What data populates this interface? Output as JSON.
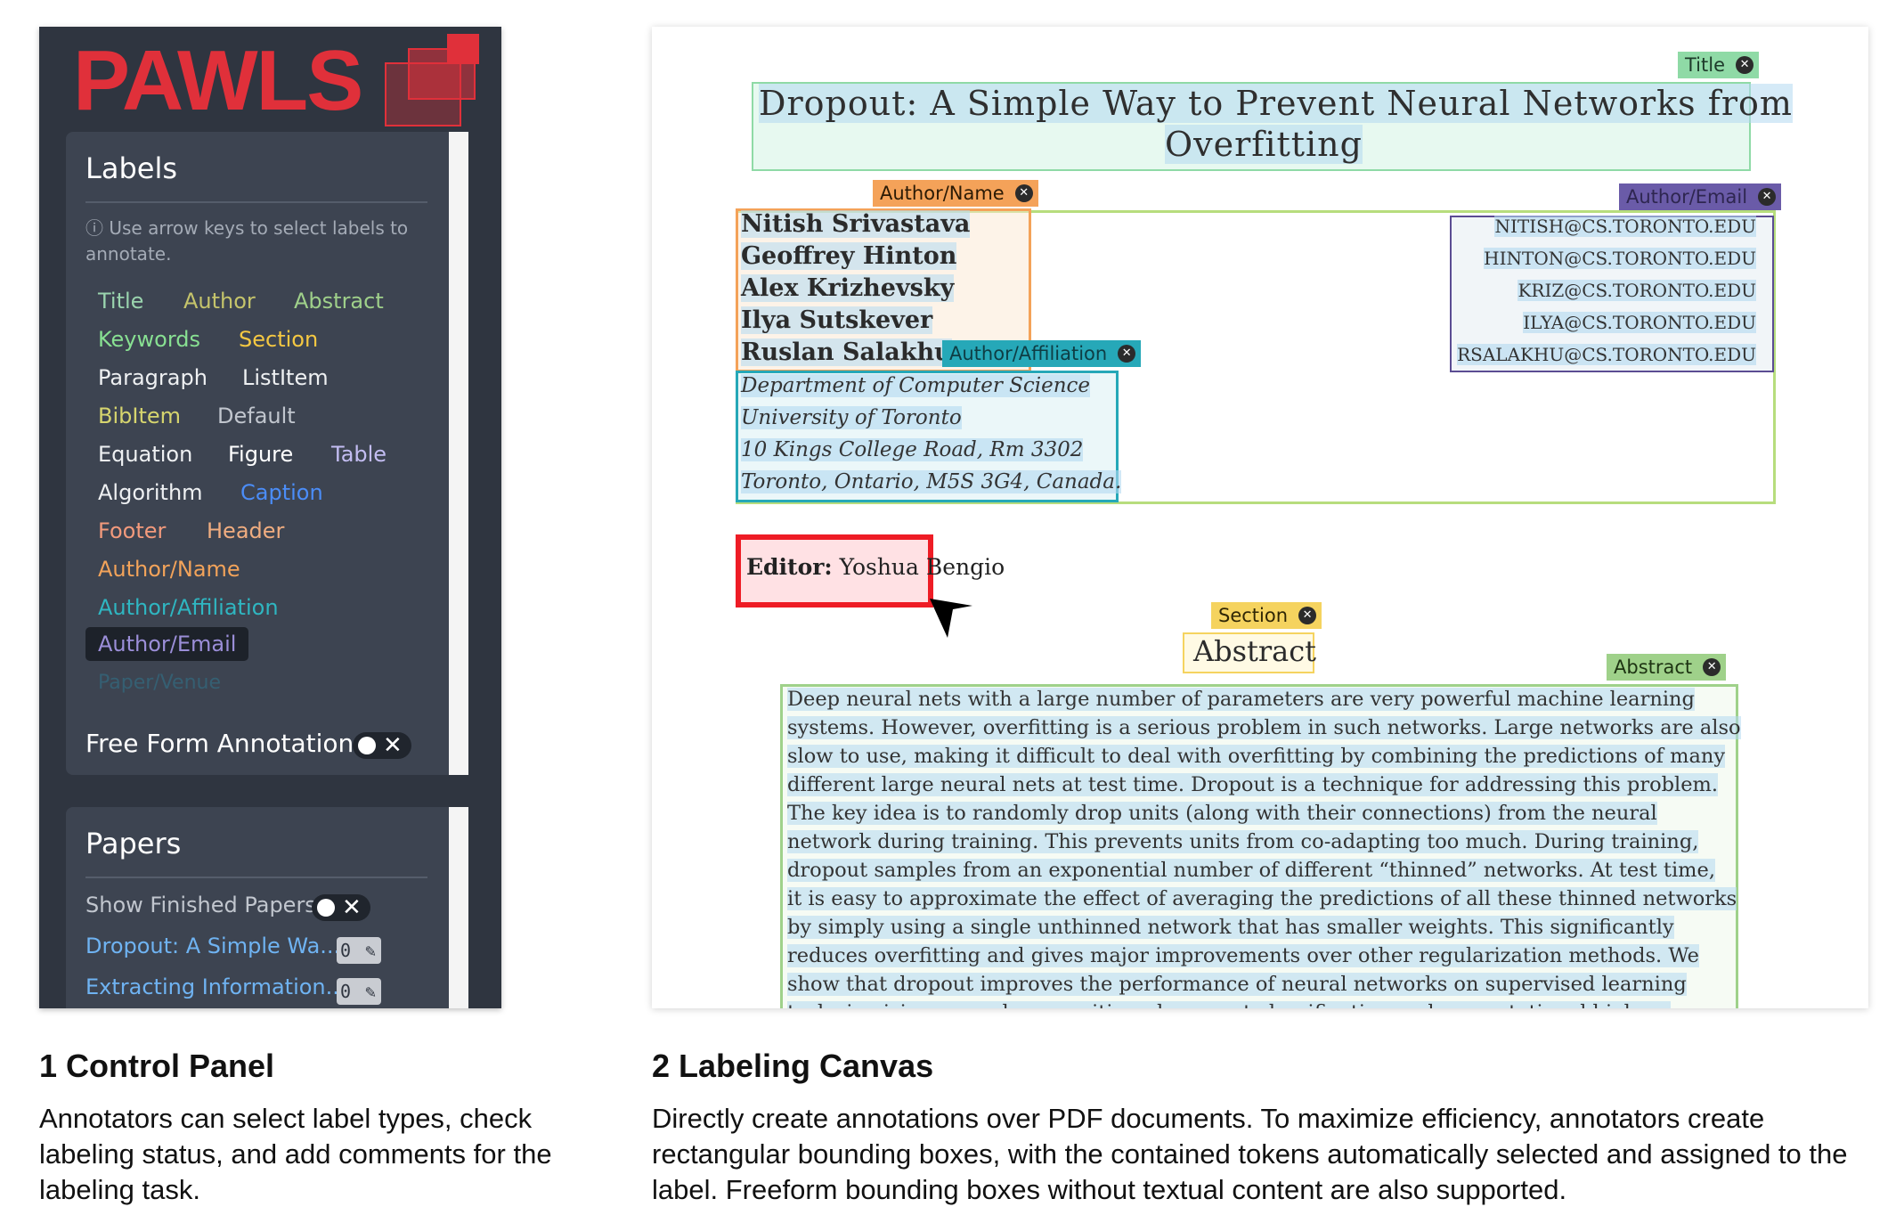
{
  "logo": {
    "text": "PAWLS"
  },
  "labels_card": {
    "heading": "Labels",
    "hint": "Use arrow keys to select labels to annotate.",
    "labels": {
      "title": "Title",
      "author": "Author",
      "abstract": "Abstract",
      "keywords": "Keywords",
      "section": "Section",
      "paragraph": "Paragraph",
      "listitem": "ListItem",
      "bibitem": "BibItem",
      "default": "Default",
      "equation": "Equation",
      "figure": "Figure",
      "table": "Table",
      "algorithm": "Algorithm",
      "caption": "Caption",
      "footer": "Footer",
      "header": "Header",
      "author_name": "Author/Name",
      "author_affiliation": "Author/Affiliation",
      "author_email": "Author/Email",
      "paper_venue": "Paper/Venue"
    },
    "selected_label": "Author/Email",
    "free_form_label": "Free Form Annotations",
    "free_form_toggle_symbol": "✕"
  },
  "papers_card": {
    "heading": "Papers",
    "show_finished_label": "Show Finished Papers:",
    "show_finished_toggle_symbol": "✕",
    "papers": [
      {
        "title": "Dropout: A Simple Wa...",
        "count": "0"
      },
      {
        "title": "Extracting Information...",
        "count": "0"
      }
    ]
  },
  "canvas": {
    "title_tag": "Title",
    "title_lines": [
      "Dropout: A Simple Way to Prevent Neural Networks from",
      "Overfitting"
    ],
    "author_name_tag": "Author/Name",
    "author_names": [
      "Nitish Srivastava",
      "Geoffrey Hinton",
      "Alex Krizhevsky",
      "Ilya Sutskever",
      "Ruslan Salakhu"
    ],
    "author_email_tag": "Author/Email",
    "author_emails": [
      "NITISH@CS.TORONTO.EDU",
      "HINTON@CS.TORONTO.EDU",
      "KRIZ@CS.TORONTO.EDU",
      "ILYA@CS.TORONTO.EDU",
      "RSALAKHU@CS.TORONTO.EDU"
    ],
    "author_affiliation_tag": "Author/Affiliation",
    "affiliation_lines": [
      "Department of Computer Science",
      "University of Toronto",
      "10 Kings College Road, Rm 3302",
      "Toronto, Ontario, M5S 3G4, Canada."
    ],
    "editor_label": "Editor:",
    "editor_name": "Yoshua Bengio",
    "section_tag": "Section",
    "section_text": "Abstract",
    "abstract_tag": "Abstract",
    "abstract_lines": [
      "Deep neural nets with a large number of parameters are very powerful machine learning",
      "systems. However, overfitting is a serious problem in such networks. Large networks are also",
      "slow to use, making it difficult to deal with overfitting by combining the predictions of many",
      "different large neural nets at test time. Dropout is a technique for addressing this problem.",
      "The key idea is to randomly drop units (along with their connections) from the neural",
      "network during training. This prevents units from co-adapting too much. During training,",
      "dropout samples from an exponential number of different “thinned” networks. At test time,",
      "it is easy to approximate the effect of averaging the predictions of all these thinned networks",
      "by simply using a single unthinned network that has smaller weights. This significantly",
      "reduces overfitting and gives major improvements over other regularization methods. We",
      "show that dropout improves the performance of neural networks on supervised learning",
      "tasks in vision, speech recognition, document classification and computational biology,"
    ]
  },
  "captions": {
    "panel_title": "1 Control Panel",
    "panel_body": "Annotators can select label types, check labeling status, and add comments for the labeling task.",
    "canvas_title": "2 Labeling Canvas",
    "canvas_body": "Directly create annotations over PDF documents. To maximize efficiency, annotators create rectangular bounding boxes, with the contained tokens automatically selected and assigned to the label. Freeform bounding boxes without textual content are also supported."
  },
  "colors": {
    "brand": "#e0303a",
    "panel_bg": "#2f3540",
    "title": "#8fdaa6",
    "author": "#b7dd7d",
    "author_name": "#f4a259",
    "author_affiliation": "#26a8b8",
    "author_email": "#6a5ba8",
    "section": "#f5d35f",
    "abstract": "#9fd18a",
    "freeform": "#ee1c25"
  },
  "icons": [
    "info-icon",
    "close-icon",
    "edit-pencil-icon",
    "cursor-arrow-icon"
  ]
}
